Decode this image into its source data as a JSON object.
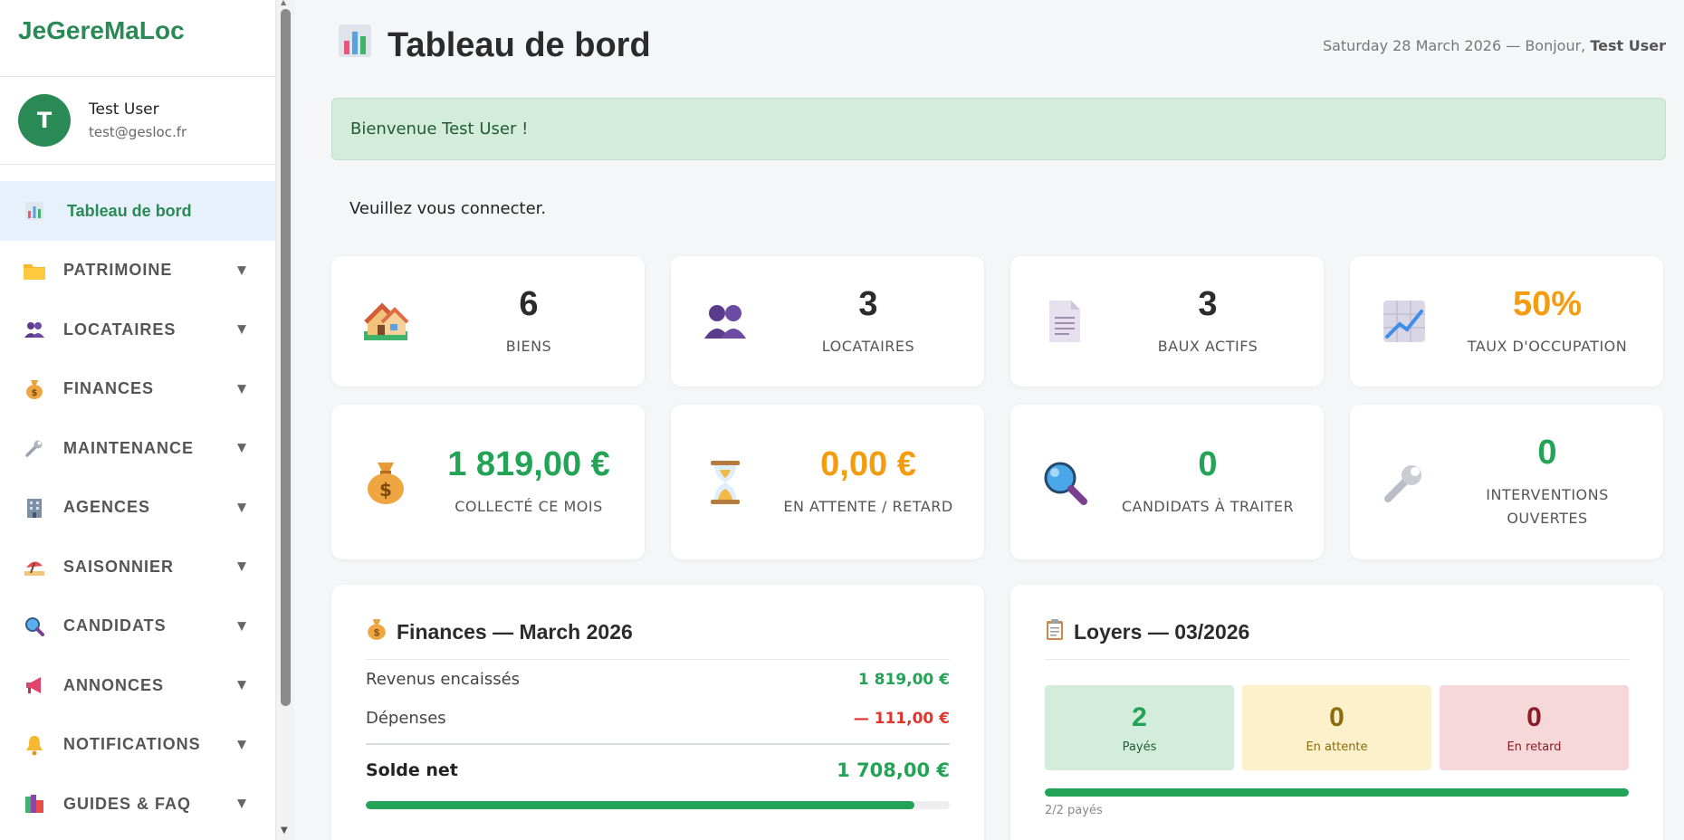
{
  "brand": "JeGereMaLoc",
  "user": {
    "initial": "T",
    "name": "Test User",
    "email": "test@gesloc.fr"
  },
  "nav": [
    {
      "label": "Tableau de bord",
      "icon": "bar-chart-icon",
      "active": true
    },
    {
      "label": "PATRIMOINE",
      "icon": "folder-icon"
    },
    {
      "label": "LOCATAIRES",
      "icon": "users-icon"
    },
    {
      "label": "FINANCES",
      "icon": "money-bag-icon"
    },
    {
      "label": "MAINTENANCE",
      "icon": "wrench-icon"
    },
    {
      "label": "AGENCES",
      "icon": "building-icon"
    },
    {
      "label": "SAISONNIER",
      "icon": "beach-umbrella-icon"
    },
    {
      "label": "CANDIDATS",
      "icon": "magnifier-icon"
    },
    {
      "label": "ANNONCES",
      "icon": "megaphone-icon"
    },
    {
      "label": "NOTIFICATIONS",
      "icon": "bell-icon"
    },
    {
      "label": "GUIDES & FAQ",
      "icon": "books-icon"
    }
  ],
  "header": {
    "title": "Tableau de bord",
    "date_greeting": "Saturday 28 March 2026 — Bonjour,",
    "user_name": "Test User"
  },
  "alert": "Bienvenue Test User !",
  "login_message": "Veuillez vous connecter.",
  "stats_row1": [
    {
      "value": "6",
      "label": "BIENS",
      "icon": "house-icon"
    },
    {
      "value": "3",
      "label": "LOCATAIRES",
      "icon": "users-icon"
    },
    {
      "value": "3",
      "label": "BAUX ACTIFS",
      "icon": "document-icon"
    },
    {
      "value": "50%",
      "label": "TAUX D'OCCUPATION",
      "icon": "trend-chart-icon",
      "accent": "orange"
    }
  ],
  "stats_row2": [
    {
      "value": "1 819,00 €",
      "label": "COLLECTÉ CE MOIS",
      "icon": "money-bag-icon",
      "accent": "green"
    },
    {
      "value": "0,00 €",
      "label": "EN ATTENTE / RETARD",
      "icon": "hourglass-icon",
      "accent": "orange"
    },
    {
      "value": "0",
      "label": "CANDIDATS À TRAITER",
      "icon": "magnifier-icon",
      "accent": "green"
    },
    {
      "value": "0",
      "label": "INTERVENTIONS OUVERTES",
      "icon": "wrench-icon",
      "accent": "green"
    }
  ],
  "finances": {
    "title": "Finances — March 2026",
    "rows": [
      {
        "label": "Revenus encaissés",
        "value": "1 819,00 €"
      },
      {
        "label": "Dépenses",
        "value": "— 111,00 €"
      }
    ],
    "total_label": "Solde net",
    "total_value": "1 708,00 €",
    "progress": 0.94
  },
  "loyers": {
    "title": "Loyers — 03/2026",
    "boxes": [
      {
        "count": "2",
        "label": "Payés"
      },
      {
        "count": "0",
        "label": "En attente"
      },
      {
        "count": "0",
        "label": "En retard"
      }
    ],
    "note": "2/2 payés",
    "progress": 1.0
  },
  "colors": {
    "brand": "#2a8a55",
    "green": "#22a356",
    "orange": "#f39c12",
    "red": "#e0352b"
  }
}
